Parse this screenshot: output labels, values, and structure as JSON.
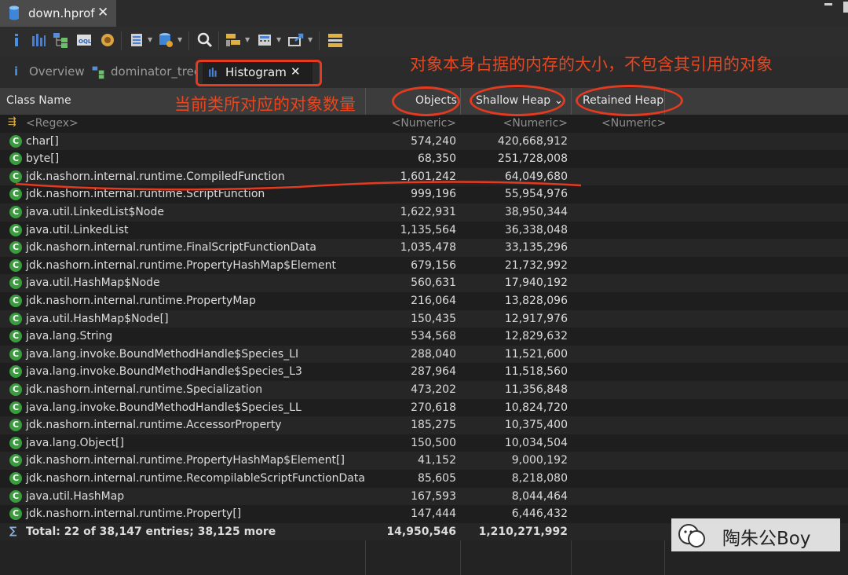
{
  "editor_tab": {
    "title": "down.hprof",
    "close": "✕"
  },
  "view_tabs": [
    {
      "label": "Overview"
    },
    {
      "label": "dominator_tree"
    },
    {
      "label": "Histogram",
      "close": "✕"
    }
  ],
  "columns": {
    "class_name": "Class Name",
    "objects": "Objects",
    "shallow_heap": "Shallow Heap",
    "shallow_heap_sort": "⌄",
    "retained_heap": "Retained Heap"
  },
  "filter_row": {
    "class_name": "<Regex>",
    "objects": "<Numeric>",
    "shallow_heap": "<Numeric>",
    "retained_heap": "<Numeric>"
  },
  "rows": [
    {
      "name": "char[]",
      "objects": "574,240",
      "shallow": "420,668,912"
    },
    {
      "name": "byte[]",
      "objects": "68,350",
      "shallow": "251,728,008"
    },
    {
      "name": "jdk.nashorn.internal.runtime.CompiledFunction",
      "objects": "1,601,242",
      "shallow": "64,049,680"
    },
    {
      "name": "jdk.nashorn.internal.runtime.ScriptFunction",
      "objects": "999,196",
      "shallow": "55,954,976"
    },
    {
      "name": "java.util.LinkedList$Node",
      "objects": "1,622,931",
      "shallow": "38,950,344"
    },
    {
      "name": "java.util.LinkedList",
      "objects": "1,135,564",
      "shallow": "36,338,048"
    },
    {
      "name": "jdk.nashorn.internal.runtime.FinalScriptFunctionData",
      "objects": "1,035,478",
      "shallow": "33,135,296"
    },
    {
      "name": "jdk.nashorn.internal.runtime.PropertyHashMap$Element",
      "objects": "679,156",
      "shallow": "21,732,992"
    },
    {
      "name": "java.util.HashMap$Node",
      "objects": "560,631",
      "shallow": "17,940,192"
    },
    {
      "name": "jdk.nashorn.internal.runtime.PropertyMap",
      "objects": "216,064",
      "shallow": "13,828,096"
    },
    {
      "name": "java.util.HashMap$Node[]",
      "objects": "150,435",
      "shallow": "12,917,976"
    },
    {
      "name": "java.lang.String",
      "objects": "534,568",
      "shallow": "12,829,632"
    },
    {
      "name": "java.lang.invoke.BoundMethodHandle$Species_LI",
      "objects": "288,040",
      "shallow": "11,521,600"
    },
    {
      "name": "java.lang.invoke.BoundMethodHandle$Species_L3",
      "objects": "287,964",
      "shallow": "11,518,560"
    },
    {
      "name": "jdk.nashorn.internal.runtime.Specialization",
      "objects": "473,202",
      "shallow": "11,356,848"
    },
    {
      "name": "java.lang.invoke.BoundMethodHandle$Species_LL",
      "objects": "270,618",
      "shallow": "10,824,720"
    },
    {
      "name": "jdk.nashorn.internal.runtime.AccessorProperty",
      "objects": "185,275",
      "shallow": "10,375,400"
    },
    {
      "name": "java.lang.Object[]",
      "objects": "150,500",
      "shallow": "10,034,504"
    },
    {
      "name": "jdk.nashorn.internal.runtime.PropertyHashMap$Element[]",
      "objects": "41,152",
      "shallow": "9,000,192"
    },
    {
      "name": "jdk.nashorn.internal.runtime.RecompilableScriptFunctionData",
      "objects": "85,605",
      "shallow": "8,218,080"
    },
    {
      "name": "java.util.HashMap",
      "objects": "167,593",
      "shallow": "8,044,464"
    },
    {
      "name": "jdk.nashorn.internal.runtime.Property[]",
      "objects": "147,444",
      "shallow": "6,446,432"
    }
  ],
  "class_icon_letter": "C",
  "total": {
    "label": "Total: 22 of 38,147 entries; 38,125 more",
    "objects": "14,950,546",
    "shallow": "1,210,271,992"
  },
  "annotations": {
    "objects_note": "当前类所对应的对象数量",
    "shallow_note": "对象本身占据的内存的大小，不包含其引用的对象",
    "color": "#e43a1f"
  },
  "watermark": {
    "text": "陶朱公Boy"
  },
  "colors": {
    "class_icon": "#3b9b3f",
    "background": "#232323",
    "header": "#3c3c3c"
  },
  "icons": [
    "info-icon",
    "histogram-icon",
    "dominator-tree-icon",
    "oql-icon",
    "thread-icon",
    "query-browser-icon",
    "heap-dump-icon",
    "search-icon",
    "group-by-icon",
    "calculator-icon",
    "export-icon",
    "layout-icon",
    "database-icon",
    "close-icon",
    "regex-filter-icon",
    "class-icon",
    "sort-icon"
  ]
}
